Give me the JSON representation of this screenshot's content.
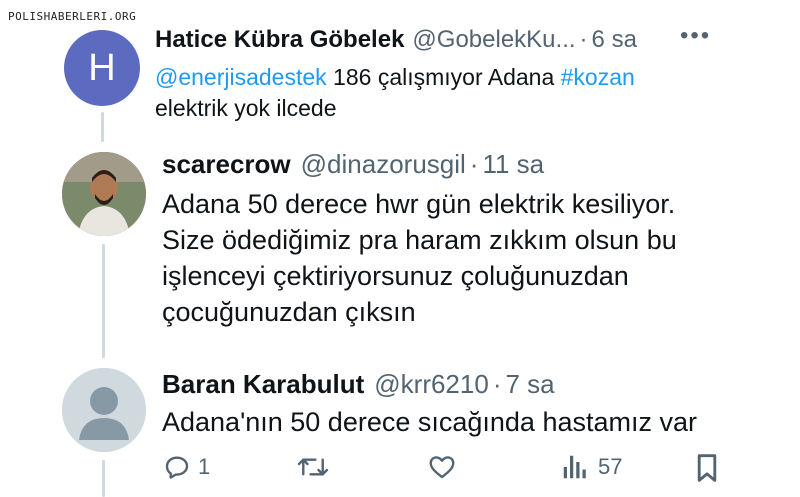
{
  "watermark": "POLISHABERLERI.ORG",
  "tweets": [
    {
      "avatar_letter": "H",
      "name": "Hatice Kübra Göbelek",
      "handle": "@GobelekKu...",
      "dot": "·",
      "time": "6 sa",
      "mention": "@enerjisadestek",
      "text_mid": " 186 çalışmıyor Adana ",
      "hashtag": "#kozan",
      "text_line2": "elektrik yok ilcede"
    },
    {
      "name": "scarecrow",
      "handle": "@dinazorusgil",
      "dot": "·",
      "time": "11 sa",
      "lines": [
        "Adana 50 derece hwr gün elektrik kesiliyor.",
        "Size ödediğimiz pra haram zıkkım olsun bu",
        "işlenceyi çektiriyorsunuz çoluğunuzdan",
        "çocuğunuzdan çıksın"
      ]
    },
    {
      "name": "Baran Karabulut",
      "handle": "@krr6210",
      "dot": "·",
      "time": "7 sa",
      "text": "Adana'nın 50 derece sıcağında hastamız var"
    }
  ],
  "more_icon": "more-dots-icon",
  "actions": {
    "reply_count": "1",
    "retweet_count": "",
    "like_count": "",
    "views_count": "57",
    "icons": [
      "reply-icon",
      "retweet-icon",
      "like-icon",
      "views-icon",
      "bookmark-icon"
    ]
  },
  "colors": {
    "link": "#1d9bf0",
    "secondary": "#536471",
    "thread_line": "#cfd9de",
    "avatar_h": "#5c6bc0"
  }
}
